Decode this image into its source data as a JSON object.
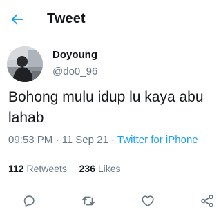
{
  "header": {
    "title": "Tweet",
    "back_icon": "arrow-left-icon",
    "accent_color": "#1da1f2"
  },
  "tweet": {
    "author": {
      "display_name": "Doyoung",
      "handle": "@do0_96"
    },
    "text": "Bohong mulu idup lu kaya abu lahab",
    "time": "09:53 PM",
    "separator": "·",
    "date": "11 Sep 21",
    "source": "Twitter for iPhone"
  },
  "stats": {
    "retweets_count": "112",
    "retweets_label": "Retweets",
    "likes_count": "236",
    "likes_label": "Likes"
  },
  "actions": {
    "reply_icon": "reply-icon",
    "retweet_icon": "retweet-icon",
    "like_icon": "heart-icon",
    "share_icon": "share-icon"
  }
}
